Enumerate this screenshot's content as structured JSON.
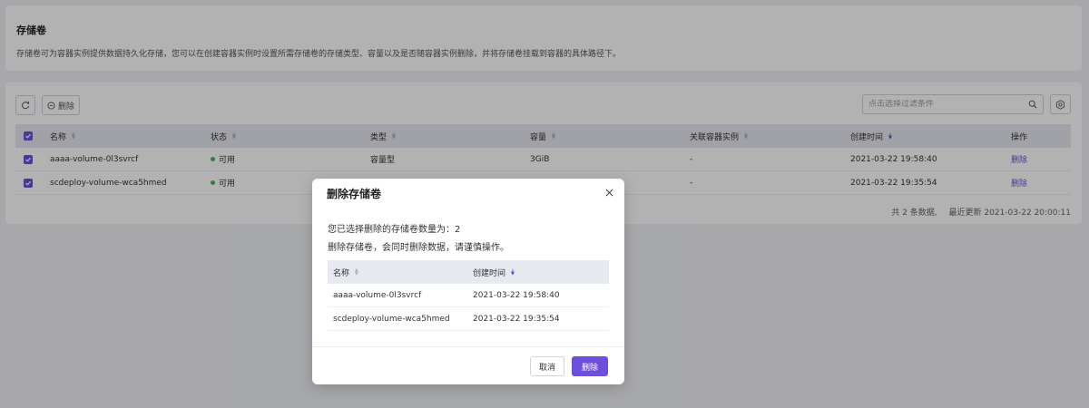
{
  "intro": {
    "title": "存储卷",
    "description": "存储卷可为容器实例提供数据持久化存储，您可以在创建容器实例时设置所需存储卷的存储类型、容量以及是否随容器实例删除，并将存储卷挂载到容器的具体路径下。"
  },
  "toolbar": {
    "delete_label": "删除",
    "filter_placeholder": "点击选择过滤条件"
  },
  "table": {
    "columns": [
      "名称",
      "状态",
      "类型",
      "容量",
      "关联容器实例",
      "创建时间",
      "操作"
    ],
    "rows": [
      {
        "name": "aaaa-volume-0l3svrcf",
        "status": "可用",
        "type": "容量型",
        "capacity": "3GiB",
        "instance": "-",
        "created": "2021-03-22 19:58:40",
        "action": "删除"
      },
      {
        "name": "scdeploy-volume-wca5hmed",
        "status": "可用",
        "type": "",
        "capacity": "",
        "instance": "-",
        "created": "2021-03-22 19:35:54",
        "action": "删除"
      }
    ]
  },
  "footer": {
    "count": "共 2 条数据,",
    "updated": "最近更新   2021-03-22 20:00:11"
  },
  "modal": {
    "title": "删除存储卷",
    "line1": "您已选择删除的存储卷数量为：2",
    "line2": "删除存储卷，会同时删除数据，请谨慎操作。",
    "columns": [
      "名称",
      "创建时间"
    ],
    "rows": [
      {
        "name": "aaaa-volume-0l3svrcf",
        "created": "2021-03-22 19:58:40"
      },
      {
        "name": "scdeploy-volume-wca5hmed",
        "created": "2021-03-22 19:35:54"
      }
    ],
    "cancel_label": "取消",
    "confirm_label": "删除"
  },
  "colors": {
    "accent": "#6e4fdc",
    "status_ok": "#4cb84c"
  }
}
